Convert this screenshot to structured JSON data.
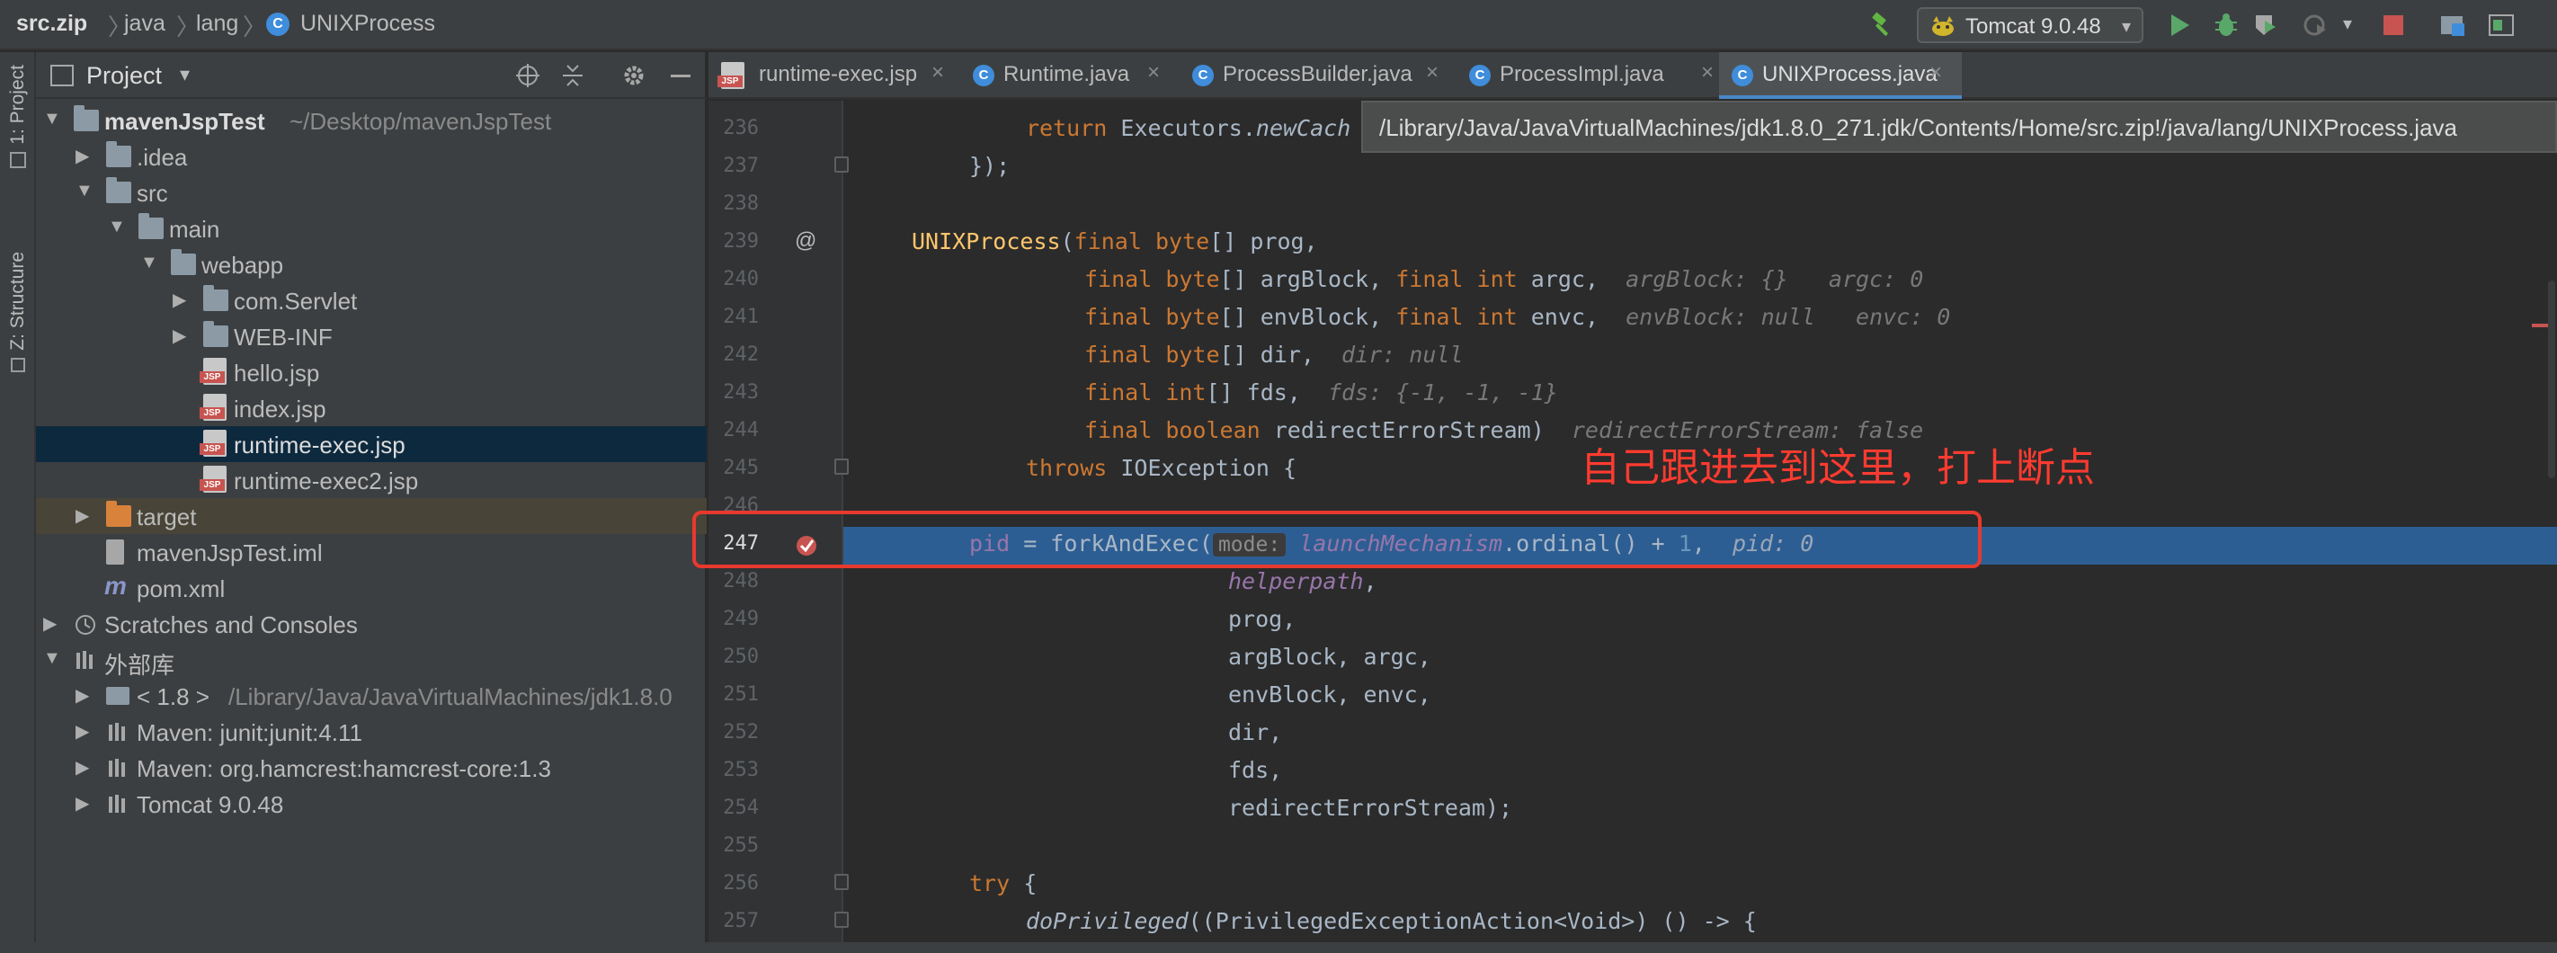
{
  "navbar": {
    "breadcrumbs": [
      "src.zip",
      "java",
      "lang",
      "UNIXProcess"
    ],
    "run_config": "Tomcat 9.0.48",
    "icons": [
      "build-icon",
      "run-icon",
      "debug-icon",
      "coverage-icon",
      "profile-icon",
      "stop-icon",
      "project-structure-icon",
      "layout-icon"
    ]
  },
  "toolstrip": {
    "project_tab": "1: Project",
    "structure_tab": "Z: Structure"
  },
  "project_panel": {
    "title": "Project",
    "tree": [
      {
        "label": "mavenJspTest",
        "extra": "~/Desktop/mavenJspTest",
        "kind": "module"
      },
      {
        "label": ".idea",
        "kind": "folder"
      },
      {
        "label": "src",
        "kind": "folder"
      },
      {
        "label": "main",
        "kind": "folder"
      },
      {
        "label": "webapp",
        "kind": "folder"
      },
      {
        "label": "com.Servlet",
        "kind": "folder"
      },
      {
        "label": "WEB-INF",
        "kind": "folder"
      },
      {
        "label": "hello.jsp",
        "kind": "jsp"
      },
      {
        "label": "index.jsp",
        "kind": "jsp"
      },
      {
        "label": "runtime-exec.jsp",
        "kind": "jsp",
        "selected": true
      },
      {
        "label": "runtime-exec2.jsp",
        "kind": "jsp"
      },
      {
        "label": "target",
        "kind": "folder-excluded"
      },
      {
        "label": "mavenJspTest.iml",
        "kind": "iml"
      },
      {
        "label": "pom.xml",
        "kind": "maven"
      },
      {
        "label": "Scratches and Consoles",
        "kind": "scratch"
      },
      {
        "label": "外部库",
        "kind": "library"
      },
      {
        "label": "< 1.8 >",
        "extra": "/Library/Java/JavaVirtualMachines/jdk1.8.0",
        "kind": "sdk"
      },
      {
        "label": "Maven: junit:junit:4.11",
        "kind": "library"
      },
      {
        "label": "Maven: org.hamcrest:hamcrest-core:1.3",
        "kind": "library"
      },
      {
        "label": "Tomcat 9.0.48",
        "kind": "library"
      }
    ]
  },
  "tabs": [
    {
      "label": "runtime-exec.jsp",
      "icon": "jsp-file-icon"
    },
    {
      "label": "Runtime.java",
      "icon": "class-icon"
    },
    {
      "label": "ProcessBuilder.java",
      "icon": "class-icon"
    },
    {
      "label": "ProcessImpl.java",
      "icon": "class-icon"
    },
    {
      "label": "UNIXProcess.java",
      "icon": "class-icon",
      "active": true
    }
  ],
  "tooltip_path": "/Library/Java/JavaVirtualMachines/jdk1.8.0_271.jdk/Contents/Home/src.zip!/java/lang/UNIXProcess.java",
  "editor": {
    "line_numbers": [
      "236",
      "237",
      "238",
      "239",
      "240",
      "241",
      "242",
      "243",
      "244",
      "245",
      "246",
      "247",
      "248",
      "249",
      "250",
      "251",
      "252",
      "253",
      "254",
      "255",
      "256",
      "257"
    ],
    "current_line": "247",
    "code": {
      "l236_kw": "return",
      "l236_rest": " Executors.",
      "l236_call": "newCach",
      "l237": "});",
      "l239_name": "UNIXProcess",
      "l239_final": "final",
      "l239_type": "byte",
      "l239_rest": "[] prog,",
      "l240_type": "byte",
      "l240_a": "[] argBlock, ",
      "l240_int": "int",
      "l240_b": " argc,",
      "l240_hint": "argBlock: {}   argc: 0",
      "l241_a": "[] envBlock, ",
      "l241_b": " envc,",
      "l241_hint": "envBlock: null   envc: 0",
      "l242_a": "[] dir,",
      "l242_hint": "dir: null",
      "l243_int": "int",
      "l243_a": "[] fds,",
      "l243_hint": "fds: {-1, -1, -1}",
      "l244_bool": "boolean",
      "l244_a": " redirectErrorStream)",
      "l244_hint": "redirectErrorStream: false",
      "l245_throws": "throws",
      "l245_a": " IOException {",
      "l247_pid": "pid",
      "l247_a": " = forkAndExec(",
      "l247_param": "mode:",
      "l247_mech": "launchMechanism",
      "l247_b": ".ordinal() + ",
      "l247_num": "1",
      "l247_c": ",",
      "l247_hint": "pid: 0",
      "l248": "helperpath",
      "l248_c": ",",
      "l249": "prog,",
      "l250": "argBlock, argc,",
      "l251": "envBlock, envc,",
      "l252": "dir,",
      "l253": "fds,",
      "l254": "redirectErrorStream);",
      "l256_try": "try",
      "l256_a": " {",
      "l257_call": "doPrivileged",
      "l257_a": "((PrivilegedExceptionAction<Void>) () -> {"
    }
  },
  "annotation": "自己跟进去到这里，打上断点",
  "colors": {
    "background": "#2b2b2b",
    "panel": "#3c3f41",
    "keyword": "#cc7832",
    "method": "#ffc66d",
    "field": "#9876aa",
    "number": "#6897bb",
    "selection": "#2d5e93",
    "annotation": "#ff3b30"
  }
}
